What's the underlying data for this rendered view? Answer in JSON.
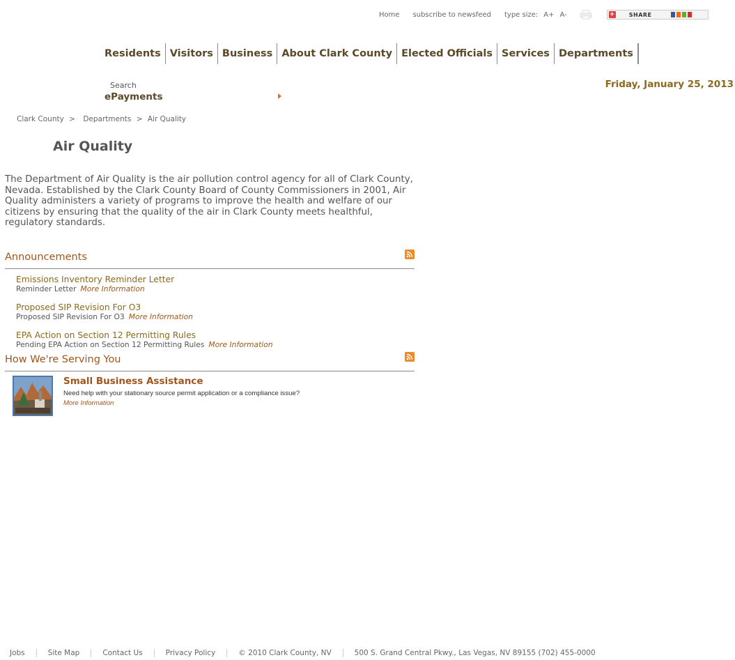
{
  "utility": {
    "home": "Home",
    "newsfeed": "subscribe to newsfeed",
    "type_size_label": "type size:",
    "type_size_up": "A+",
    "type_size_down": "A-",
    "share": "SHARE"
  },
  "nav": {
    "items": [
      "Residents",
      "Visitors",
      "Business",
      "About Clark County",
      "Elected Officials",
      "Services",
      "Departments"
    ]
  },
  "search": {
    "label": "Search"
  },
  "epayments": {
    "label": "ePayments"
  },
  "date": "Friday, January 25, 2013",
  "breadcrumb": {
    "root": "Clark County",
    "sep1": ">",
    "section": "Departments",
    "sep2": ">",
    "current": "Air Quality"
  },
  "page_title": "Air Quality",
  "intro": "The Department of Air Quality is the air pollution control agency for all of Clark County, Nevada. Established by the Clark County Board of County Commissioners in 2001, Air Quality administers a variety of programs to improve the health and welfare of our citizens by ensuring that the quality of the air in Clark County meets healthful, regulatory standards.",
  "announcements": {
    "title": "Announcements",
    "items": [
      {
        "title": "Emissions Inventory Reminder Letter",
        "summary": "Reminder Letter",
        "more": "More Information"
      },
      {
        "title": "Proposed SIP Revision For O3",
        "summary": "Proposed SIP Revision For O3",
        "more": "More Information"
      },
      {
        "title": "EPA Action on Section 12 Permitting Rules",
        "summary": "Pending EPA Action on Section 12 Permitting Rules",
        "more": "More Information"
      }
    ]
  },
  "serving": {
    "title": "How We're Serving You",
    "item": {
      "title": "Small Business Assistance",
      "description": "Need help with your stationary source permit application or a compliance issue?",
      "more": "More Information"
    }
  },
  "footer": {
    "jobs": "Jobs",
    "site_map": "Site Map",
    "contact": "Contact Us",
    "privacy": "Privacy Policy",
    "copyright": "© 2010 Clark County, NV",
    "address": "500 S. Grand Central Pkwy., Las Vegas, NV 89155 (702) 455-0000"
  },
  "colors": {
    "nav_text": "#5a4a2a",
    "accent": "#a0561a",
    "date": "#8a6a1e",
    "rss": "#ef8a29"
  }
}
